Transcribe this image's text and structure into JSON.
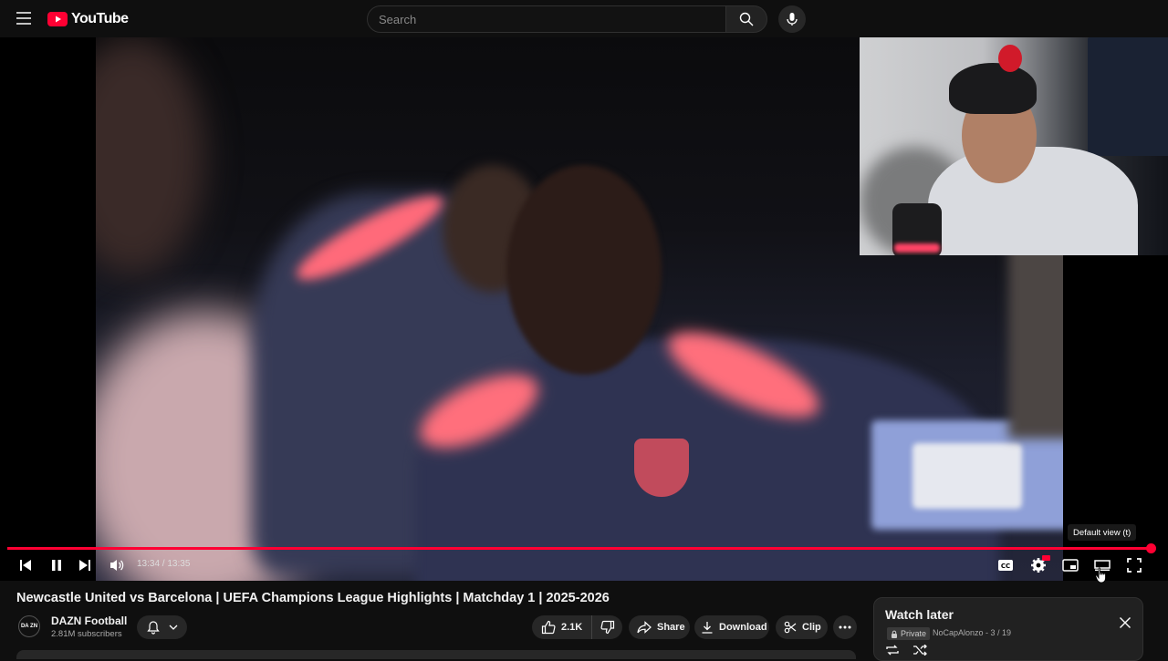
{
  "app": {
    "logo_text": "YouTube"
  },
  "search": {
    "placeholder": "Search"
  },
  "player": {
    "time_display": "13:34 / 13:35",
    "progress_fraction": 0.999,
    "tooltip": "Default view (t)"
  },
  "video": {
    "title": "Newcastle United vs Barcelona | UEFA Champions League Highlights | Matchday 1 | 2025-2026"
  },
  "channel": {
    "name": "DAZN Football",
    "subscribers": "2.81M subscribers",
    "avatar_text": "DA ZN"
  },
  "actions": {
    "likes": "2.1K",
    "share": "Share",
    "download": "Download",
    "clip": "Clip"
  },
  "playlist": {
    "title": "Watch later",
    "privacy": "Private",
    "owner_position": "NoCapAlonzo - 3 / 19"
  },
  "colors": {
    "accent": "#ff0033",
    "background": "#0f0f0f"
  },
  "icons": [
    "menu-icon",
    "youtube-logo-icon",
    "search-icon",
    "mic-icon",
    "previous-icon",
    "pause-icon",
    "next-icon",
    "volume-icon",
    "captions-icon",
    "settings-icon",
    "miniplayer-icon",
    "theater-icon",
    "fullscreen-icon",
    "bell-icon",
    "chevron-down-icon",
    "like-icon",
    "dislike-icon",
    "share-icon",
    "download-icon",
    "clip-icon",
    "more-icon",
    "close-icon",
    "lock-icon",
    "loop-icon",
    "shuffle-icon"
  ]
}
